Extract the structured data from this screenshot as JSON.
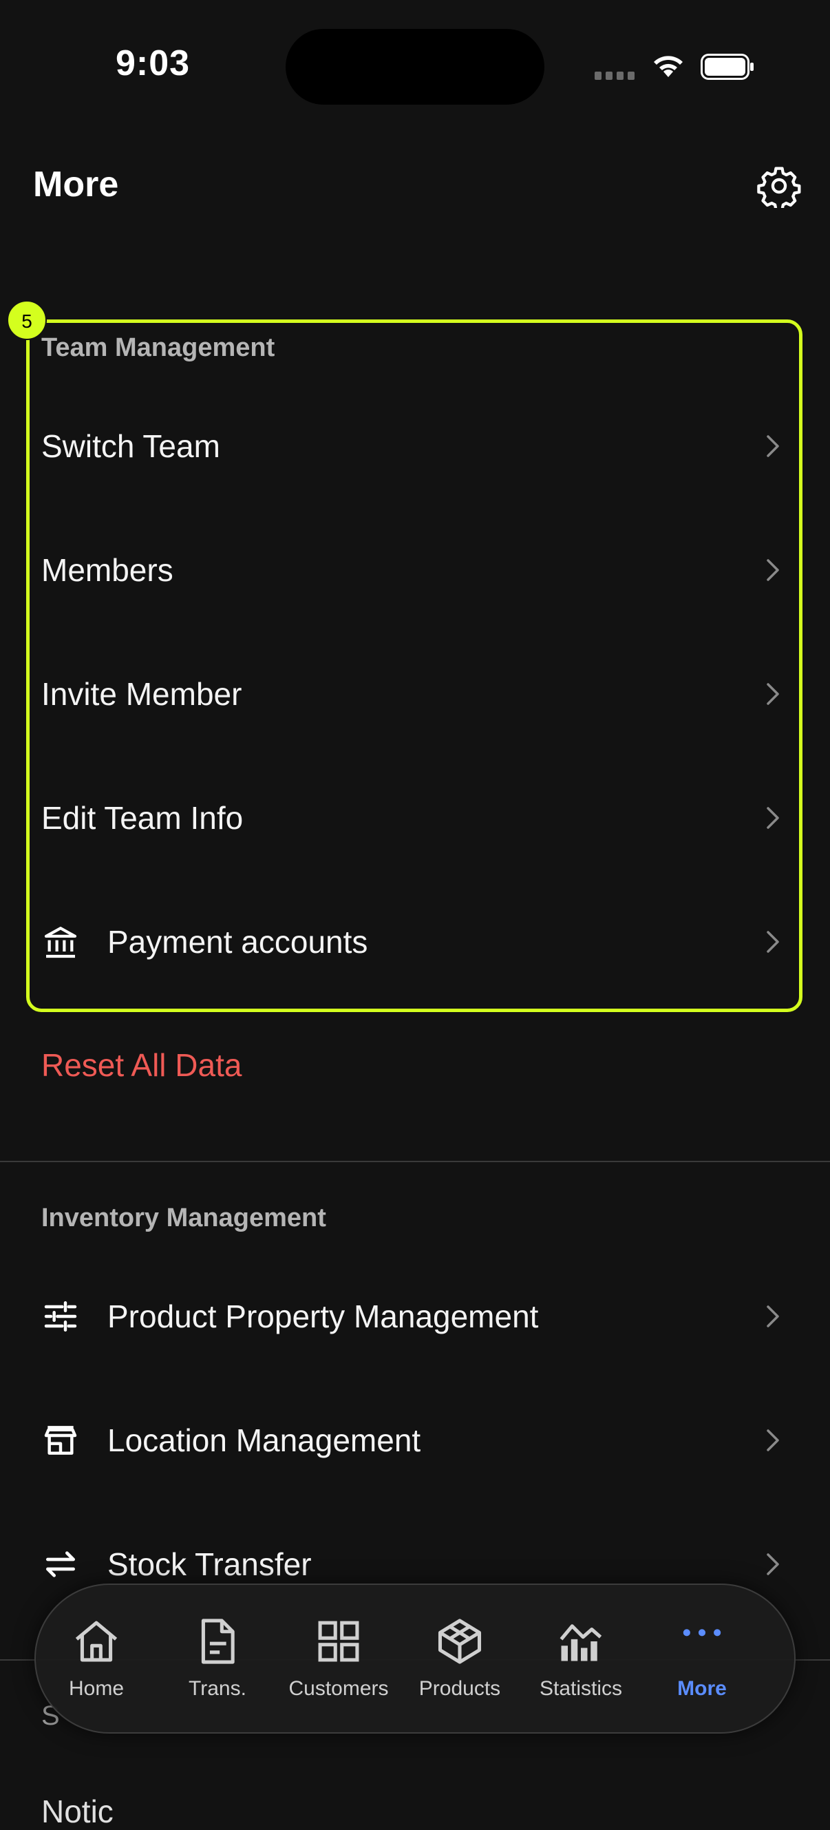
{
  "status_bar": {
    "time": "9:03"
  },
  "header": {
    "title": "More"
  },
  "badge": "5",
  "team_management": {
    "title": "Team Management",
    "items": [
      {
        "label": "Switch Team"
      },
      {
        "label": "Members"
      },
      {
        "label": "Invite Member"
      },
      {
        "label": "Edit Team Info"
      },
      {
        "label": "Payment accounts",
        "icon": "bank-icon"
      }
    ]
  },
  "reset_label": "Reset All Data",
  "inventory_management": {
    "title": "Inventory Management",
    "items": [
      {
        "label": "Product Property Management",
        "icon": "sliders-icon"
      },
      {
        "label": "Location Management",
        "icon": "store-icon"
      },
      {
        "label": "Stock Transfer",
        "icon": "transfer-icon"
      }
    ]
  },
  "partial": {
    "section_title": "S",
    "row_label": "Notic"
  },
  "tabbar": {
    "active_color": "#5b8dff",
    "tabs": [
      {
        "label": "Home",
        "icon": "home-icon"
      },
      {
        "label": "Trans.",
        "icon": "document-icon"
      },
      {
        "label": "Customers",
        "icon": "grid-icon"
      },
      {
        "label": "Products",
        "icon": "cube-icon"
      },
      {
        "label": "Statistics",
        "icon": "chart-icon"
      },
      {
        "label": "More",
        "icon": "more-icon",
        "active": true
      }
    ]
  },
  "colors": {
    "highlight": "#d4ff1e",
    "danger": "#ef5a55",
    "background": "#121212"
  }
}
